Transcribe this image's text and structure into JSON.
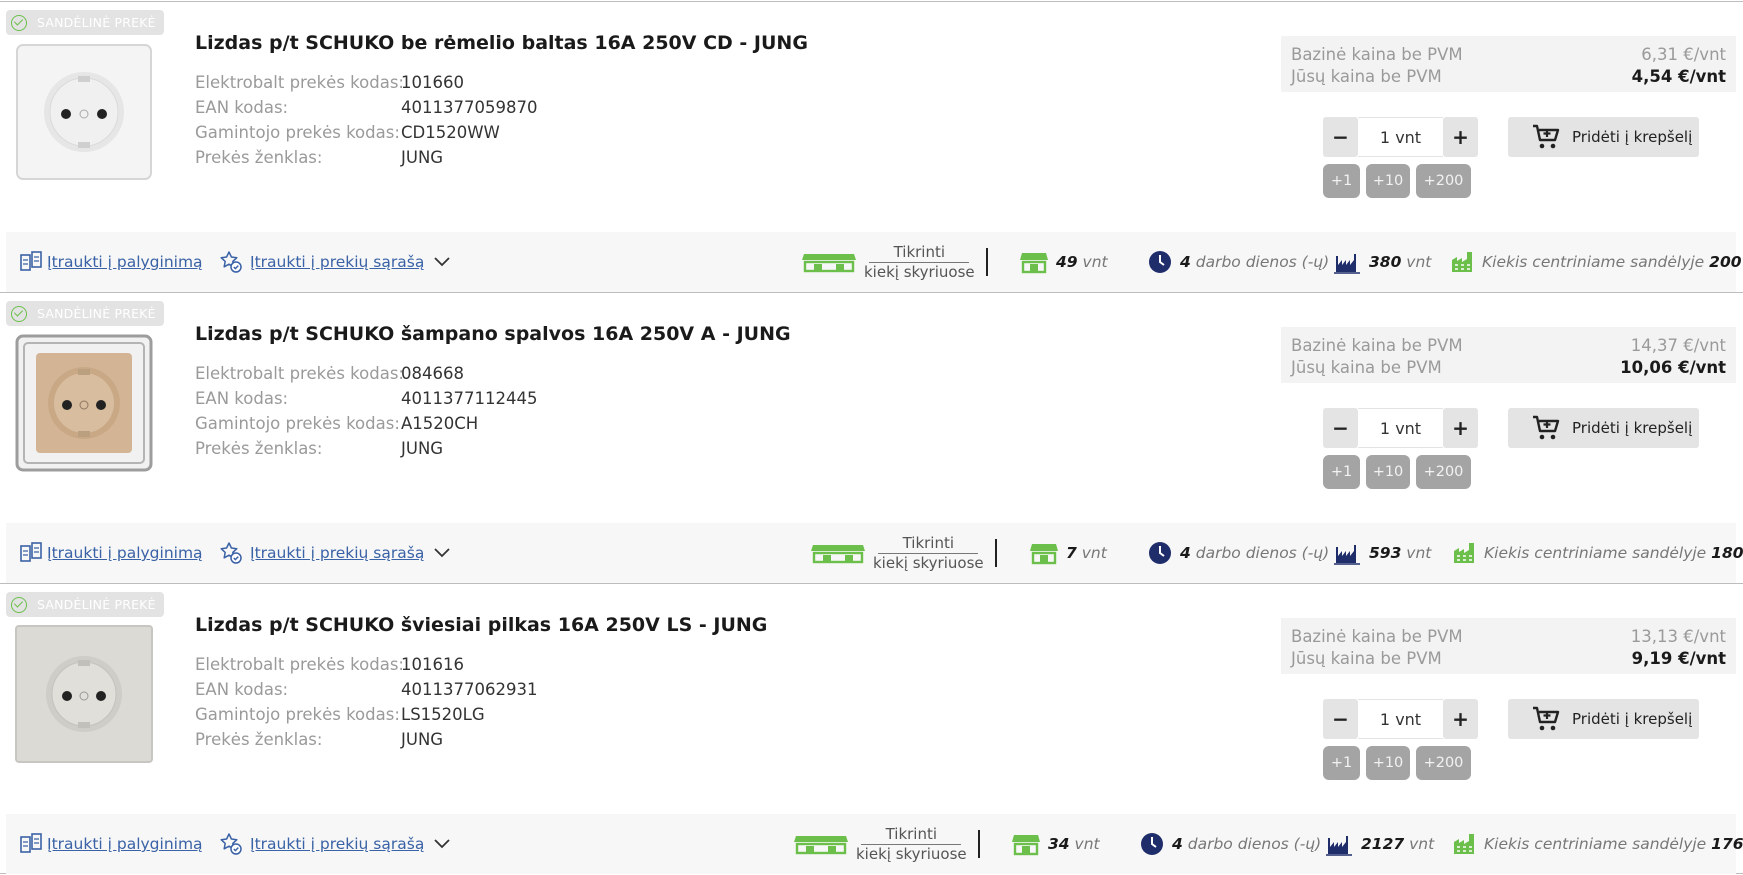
{
  "colors": {
    "link": "#3a62a6",
    "green": "#6bbf4a",
    "navy": "#1f2d6b",
    "quick_button": "#a4a4a4"
  },
  "common": {
    "badge": "SANDĖLINĖ PREKĖ",
    "spec_labels": [
      "Elektrobalt prekės kodas:",
      "EAN kodas:",
      "Gamintojo prekės kodas:",
      "Prekės ženklas:"
    ],
    "base_price_label": "Bazinė kaina be PVM",
    "your_price_label": "Jūsų kaina be PVM",
    "minus": "−",
    "plus": "+",
    "quantity": "1 vnt",
    "add_to_cart": "Pridėti į krepšelį",
    "quick_add": [
      "+1",
      "+10",
      "+200"
    ],
    "compare_link": "Įtraukti į palyginimą",
    "wishlist_link": "Įtraukti į prekių sąrašą",
    "check_line1": "Tikrinti",
    "check_line2": "kiekį skyriuose",
    "unit": "vnt",
    "delivery_days": "4",
    "delivery_text": "darbo dienos (-ų)",
    "central_label": "Kiekis centriniame sandėlyje",
    "icons": [
      "check-circle-icon",
      "cart-plus-icon",
      "compare-icon",
      "star-check-icon",
      "chevron-down-icon",
      "stores-icon",
      "store-icon",
      "clock-icon",
      "factory-icon",
      "warehouse-icon"
    ]
  },
  "products": [
    {
      "title": "Lizdas p/t SCHUKO be rėmelio baltas 16A 250V CD - JUNG",
      "specs": [
        "101660",
        "4011377059870",
        "CD1520WW",
        "JUNG"
      ],
      "base_price": "6,31 €/vnt",
      "your_price": "4,54 €/vnt",
      "store_qty": "49",
      "factory_qty": "380",
      "central_qty": "200",
      "image": "white-socket"
    },
    {
      "title": "Lizdas p/t SCHUKO šampano spalvos 16A 250V A - JUNG",
      "specs": [
        "084668",
        "4011377112445",
        "A1520CH",
        "JUNG"
      ],
      "base_price": "14,37 €/vnt",
      "your_price": "10,06 €/vnt",
      "store_qty": "7",
      "factory_qty": "593",
      "central_qty": "180",
      "image": "champagne-socket"
    },
    {
      "title": "Lizdas p/t SCHUKO šviesiai pilkas 16A 250V LS - JUNG",
      "specs": [
        "101616",
        "4011377062931",
        "LS1520LG",
        "JUNG"
      ],
      "base_price": "13,13 €/vnt",
      "your_price": "9,19 €/vnt",
      "store_qty": "34",
      "factory_qty": "2127",
      "central_qty": "176",
      "image": "light-grey-socket"
    }
  ]
}
